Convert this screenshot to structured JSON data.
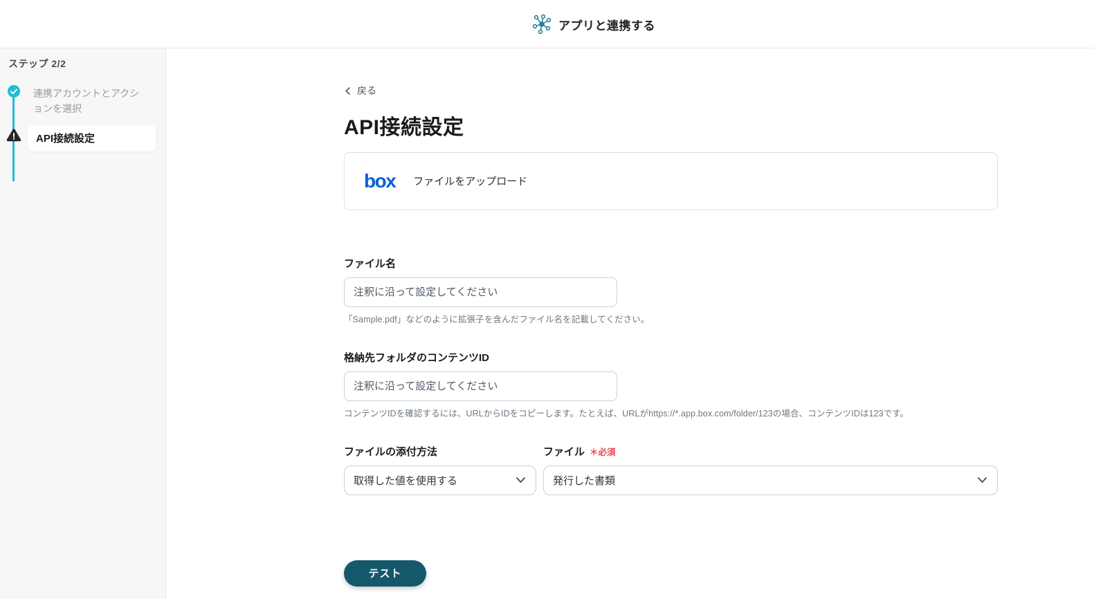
{
  "colors": {
    "accent_cyan": "#23BCD3",
    "header_icon_teal": "#2B7E99",
    "box_blue": "#0061D5",
    "required_red": "#E5484D",
    "button_teal": "#15586B"
  },
  "header": {
    "title": "アプリと連携する"
  },
  "sidebar": {
    "step_label": "ステップ 2/2",
    "steps": [
      {
        "label": "連携アカウントとアクションを選択",
        "state": "done",
        "icon": "check-icon"
      },
      {
        "label": "API接続設定",
        "state": "current",
        "icon": "warning-icon"
      }
    ]
  },
  "main": {
    "back_label": "戻る",
    "title": "API接続設定",
    "action_card": {
      "app_logo_text": "box",
      "action_label": "ファイルをアップロード"
    },
    "fields": {
      "file_name": {
        "label": "ファイル名",
        "placeholder": "注釈に沿って設定してください",
        "value": "",
        "help": "「Sample.pdf」などのように拡張子を含んだファイル名を記載してください。"
      },
      "folder_id": {
        "label": "格納先フォルダのコンテンツID",
        "placeholder": "注釈に沿って設定してください",
        "value": "",
        "help": "コンテンツIDを確認するには、URLからIDをコピーします。たとえば、URLがhttps://*.app.box.com/folder/123の場合、コンテンツIDは123です。"
      },
      "attach_method": {
        "label": "ファイルの添付方法",
        "value": "取得した値を使用する"
      },
      "file": {
        "label": "ファイル",
        "required_label": "＊必須",
        "value": "発行した書類"
      }
    },
    "test_button_label": "テスト"
  }
}
